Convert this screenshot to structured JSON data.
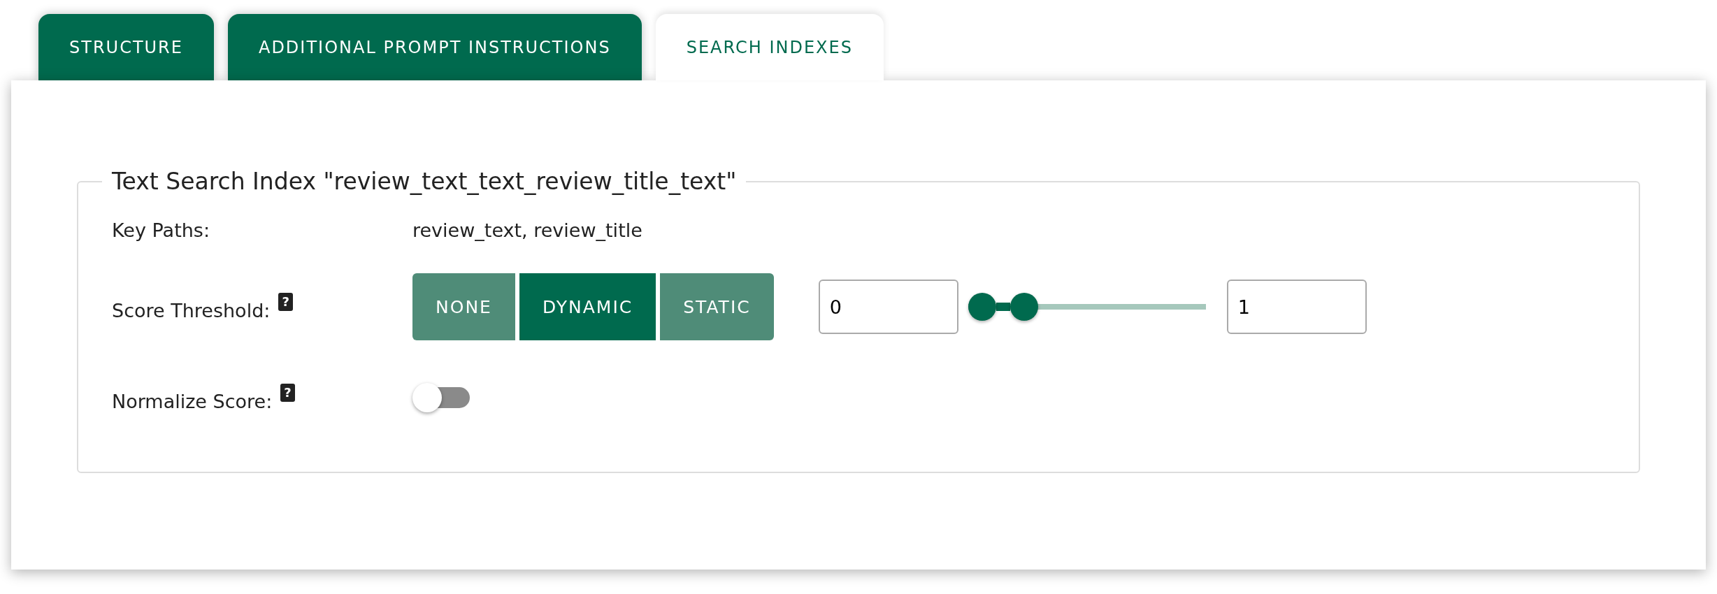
{
  "tabs": [
    {
      "label": "STRUCTURE",
      "selected": false
    },
    {
      "label": "ADDITIONAL PROMPT INSTRUCTIONS",
      "selected": false
    },
    {
      "label": "SEARCH INDEXES",
      "selected": true
    }
  ],
  "index": {
    "title": "Text Search Index \"review_text_text_review_title_text\"",
    "key_paths": {
      "label": "Key Paths:",
      "value": "review_text, review_title"
    },
    "score_threshold": {
      "label": "Score Threshold:",
      "help": "?",
      "modes": [
        {
          "label": "NONE",
          "selected": false
        },
        {
          "label": "DYNAMIC",
          "selected": true
        },
        {
          "label": "STATIC",
          "selected": false
        }
      ],
      "min_value": "0",
      "max_value": "1",
      "thumbs": [
        {
          "level": 0
        },
        {
          "level": 0.2
        }
      ]
    },
    "normalize_score": {
      "label": "Normalize Score:",
      "help": "?",
      "on": false
    }
  }
}
